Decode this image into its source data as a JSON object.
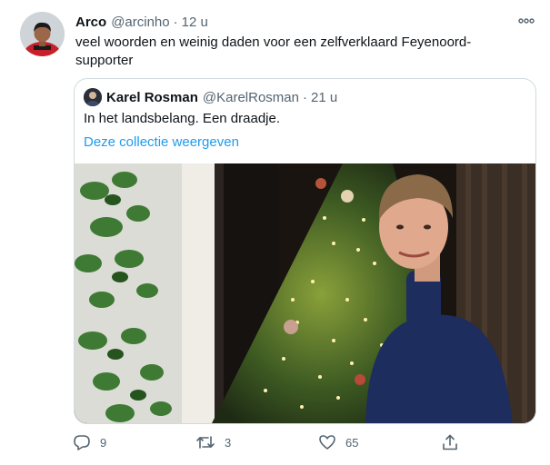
{
  "tweet": {
    "author_name": "Arco",
    "author_handle": "@arcinho",
    "separator": "·",
    "time": "12 u",
    "text": "veel woorden en weinig daden voor een zelfverklaard Feyenoord-supporter",
    "more_icon": "more-horizontal-icon"
  },
  "quote": {
    "author_name": "Karel Rosman",
    "author_handle": "@KarelRosman",
    "separator": "·",
    "time": "21 u",
    "text": "In het landsbelang. Een draadje.",
    "link_label": "Deze collectie weergeven"
  },
  "actions": {
    "reply_count": "9",
    "retweet_count": "3",
    "like_count": "65",
    "icons": [
      "reply-icon",
      "retweet-icon",
      "like-icon",
      "share-icon"
    ]
  },
  "colors": {
    "text": "#0f1419",
    "secondary": "#536471",
    "link": "#1d9bf0",
    "border": "#cfd9de"
  }
}
